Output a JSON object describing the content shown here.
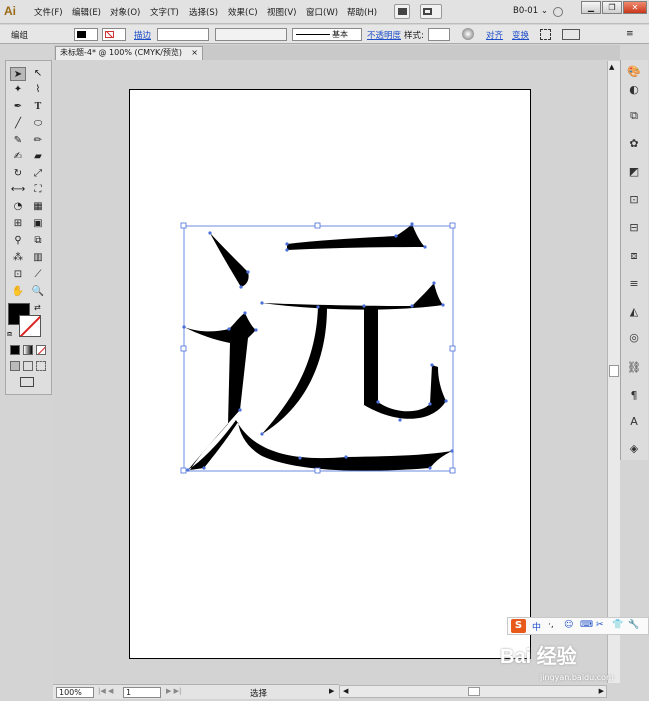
{
  "app": {
    "logo": "Ai",
    "workspace": "B0-01"
  },
  "menu": [
    "文件(F)",
    "编辑(E)",
    "对象(O)",
    "文字(T)",
    "选择(S)",
    "效果(C)",
    "视图(V)",
    "窗口(W)",
    "帮助(H)"
  ],
  "window_controls": {
    "minimize": "▁",
    "restore": "❐",
    "close": "✕"
  },
  "control_bar": {
    "selection_type": "编组",
    "stroke_label": "描边",
    "stroke_style": "基本",
    "opacity_label": "不透明度",
    "style_label": "样式:",
    "align_label": "对齐",
    "transform_label": "变换"
  },
  "document_tab": {
    "title": "未标题-4* @ 100% (CMYK/预览)",
    "close": "×"
  },
  "status_bar": {
    "zoom": "100%",
    "page": "1",
    "tool_status": "选择"
  },
  "ime_bar": {
    "logo": "S",
    "mode": "中",
    "punct": "·,",
    "items": [
      "☺",
      "⌨",
      "✂",
      "👕",
      "🔧"
    ]
  },
  "watermark": {
    "text": "Bai 经验",
    "sub": "jingyan.baidu.com"
  },
  "colors": {
    "selection": "#4a6fd8",
    "fill": "#000000",
    "artboard": "#ffffff",
    "pasteboard": "#d3d3d3"
  }
}
